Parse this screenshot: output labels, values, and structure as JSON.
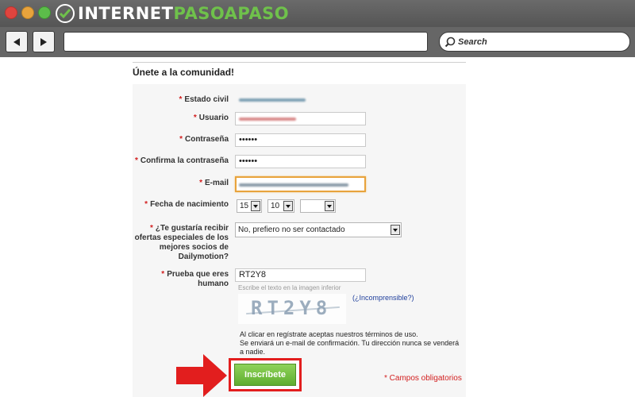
{
  "site": {
    "logo_white": "INTERNET",
    "logo_green": "PASOAPASO"
  },
  "browser": {
    "search_placeholder": "Search"
  },
  "page": {
    "title": "Únete a la comunidad!"
  },
  "form": {
    "required_mark": "*",
    "labels": {
      "estado_civil": "Estado civil",
      "usuario": "Usuario",
      "contrasena": "Contraseña",
      "confirma": "Confirma la contraseña",
      "email": "E-mail",
      "fecha": "Fecha de nacimiento",
      "ofertas": "¿Te gustaría recibir ofertas especiales de los mejores socios de Dailymotion?",
      "prueba": "Prueba que eres humano"
    },
    "values": {
      "contrasena": "••••••",
      "confirma": "••••••",
      "dia": "15",
      "mes": "10",
      "anio": "",
      "ofertas": "No, prefiero no ser contactado",
      "captcha_input": "RT2Y8"
    },
    "captcha_hint": "Escribe el texto en la imagen inferior",
    "captcha_image_text": "RT2Y8",
    "captcha_link": "(¿Incomprensible?)",
    "terms_line1": "Al clicar en regístrate aceptas nuestros términos de uso.",
    "terms_line2": "Se enviará un e-mail de confirmación. Tu dirección nunca se venderá a nadie.",
    "submit_label": "Inscríbete",
    "required_note": "* Campos obligatorios"
  },
  "colors": {
    "accent_green": "#6fc14b",
    "required_red": "#d21e1e",
    "highlight_red": "#e21e1e",
    "focus_orange": "#e8a33c"
  }
}
